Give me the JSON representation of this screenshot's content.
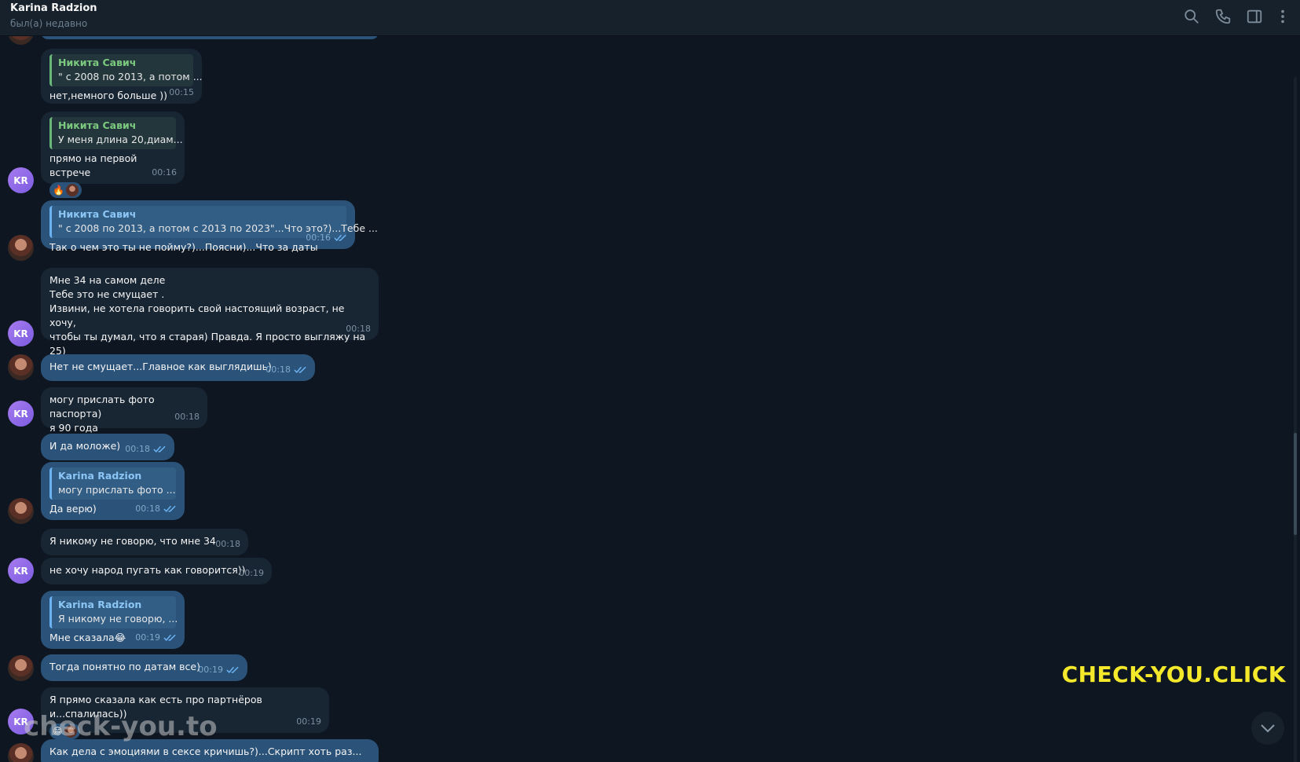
{
  "header": {
    "title": "Karina Radzion",
    "status": "был(а) недавно",
    "icons": [
      "search-icon",
      "phone-icon",
      "sidebar-icon",
      "more-icon"
    ]
  },
  "avatars": {
    "kr_initials": "KR"
  },
  "messages": [
    {
      "reply_name": "Никита Савич",
      "reply_text": "\" с 2008 по 2013, а потом ...",
      "text": "нет,немного больше ))",
      "time": "00:15"
    },
    {
      "reply_name": "Никита Савич",
      "reply_text": "У меня длина 20,диам...",
      "text": "прямо на первой встрече",
      "reaction": "🔥",
      "time": "00:16"
    },
    {
      "reply_name": "Никита Савич",
      "reply_text": "\" с 2008 по 2013, а потом с 2013 по 2023\"...Что это?)...Тебе ...",
      "text": "Так о чем это ты не пойму?)...Поясни)...Что за даты",
      "time": "00:16"
    },
    {
      "text": "Мне 34 на самом деле\nТебе это не смущает .\nИзвини, не хотела говорить свой настоящий возраст, не хочу,\nчтобы ты думал, что я старая) Правда. Я просто выгляжу на 25)",
      "time": "00:18"
    },
    {
      "text": "Нет не смущает...Главное как выглядишь)",
      "time": "00:18"
    },
    {
      "text": "могу прислать фото паспорта)\nя 90 года",
      "time": "00:18"
    },
    {
      "text": "И да моложе)",
      "time": "00:18"
    },
    {
      "reply_name": "Karina Radzion",
      "reply_text": "могу прислать фото ...",
      "text": "Да верю)",
      "time": "00:18"
    },
    {
      "text": "Я никому не говорю, что мне 34",
      "time": "00:18"
    },
    {
      "text": "не хочу народ пугать как говорится))",
      "time": "00:19"
    },
    {
      "reply_name": "Karina Radzion",
      "reply_text": "Я никому не говорю, ...",
      "text": "Мне сказала😂",
      "time": "00:19"
    },
    {
      "text": "Тогда понятно по датам все)",
      "time": "00:19"
    },
    {
      "text": "Я прямо сказала как есть про партнёров и...спалилась))",
      "reaction": "😁",
      "time": "00:19"
    },
    {
      "text": "Как дела с эмоциями в сексе кричишь?)...Скрипт хоть раз..."
    }
  ],
  "watermarks": {
    "yellow": "CHECK-YOU.CLICK",
    "gray": "check-you.to"
  },
  "colors": {
    "bg": "#0e1621",
    "incoming": "#182533",
    "outgoing": "#2b5278",
    "reply_green": "#6ab77a",
    "reply_blue": "#6ab2f2",
    "check": "#6ab2f2"
  }
}
